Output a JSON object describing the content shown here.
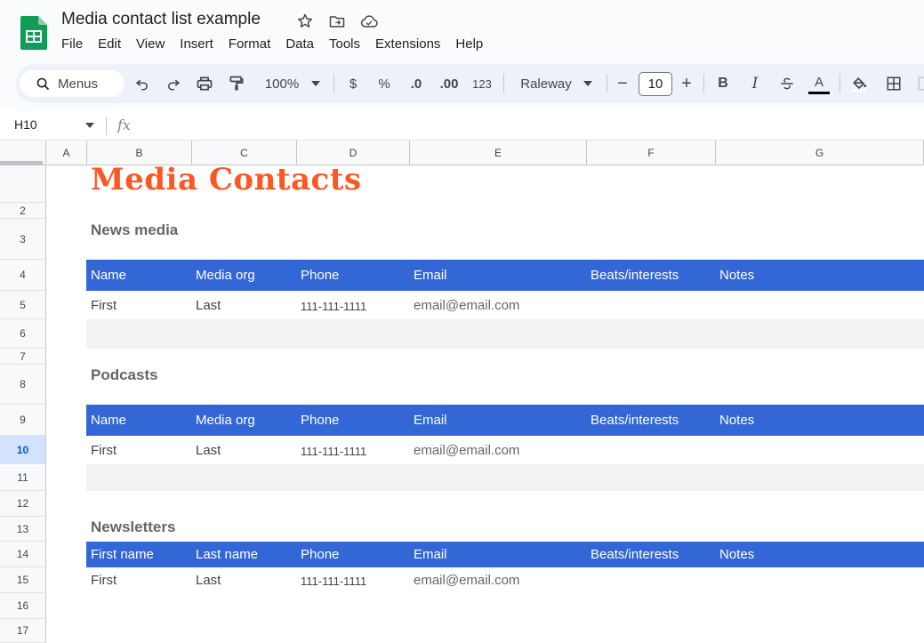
{
  "app": {
    "doc_title": "Media contact list example",
    "icons": [
      "star-icon",
      "move-to-folder-icon",
      "cloud-saved-icon"
    ],
    "menu": [
      "File",
      "Edit",
      "View",
      "Insert",
      "Format",
      "Data",
      "Tools",
      "Extensions",
      "Help"
    ]
  },
  "toolbar": {
    "menus_label": "Menus",
    "zoom": "100%",
    "currency": "$",
    "percent": "%",
    "decrease_decimal": ".0",
    "increase_decimal": ".00",
    "number_format": "123",
    "font": "Raleway",
    "font_size": "10",
    "minus": "−",
    "plus": "+",
    "bold": "B",
    "italic": "I",
    "text_color": "A"
  },
  "formula_bar": {
    "cell_ref": "H10",
    "fx": "fx"
  },
  "columns": [
    "A",
    "B",
    "C",
    "D",
    "E",
    "F",
    "G"
  ],
  "rows": [
    "2",
    "3",
    "4",
    "5",
    "6",
    "7",
    "8",
    "9",
    "10",
    "11",
    "12",
    "13",
    "14",
    "15",
    "16",
    "17"
  ],
  "sheet": {
    "title": "Media Contacts",
    "sections": [
      {
        "title": "News media",
        "headers": [
          "Name",
          "Media org",
          "Phone",
          "Email",
          "Beats/interests",
          "Notes"
        ],
        "row": [
          "First",
          "Last",
          "111-111-1111",
          "email@email.com"
        ]
      },
      {
        "title": "Podcasts",
        "headers": [
          "Name",
          "Media org",
          "Phone",
          "Email",
          "Beats/interests",
          "Notes"
        ],
        "row": [
          "First",
          "Last",
          "111-111-1111",
          "email@email.com"
        ]
      },
      {
        "title": "Newsletters",
        "headers": [
          "First name",
          "Last name",
          "Phone",
          "Email",
          "Beats/interests",
          "Notes"
        ],
        "row": [
          "First",
          "Last",
          "111-111-1111",
          "email@email.com"
        ]
      }
    ]
  },
  "colors": {
    "title_orange": "#ff5722",
    "header_blue": "#3367d6",
    "logo_green": "#0f9d58"
  }
}
